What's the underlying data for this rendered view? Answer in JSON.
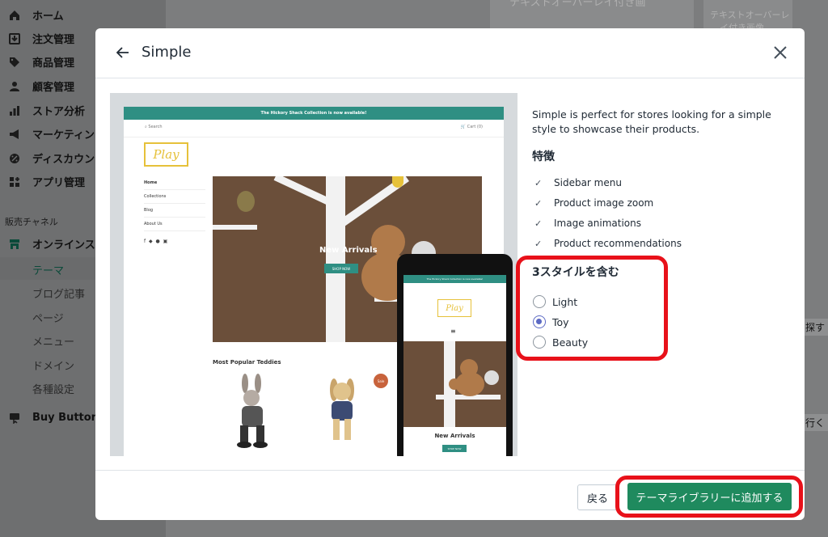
{
  "sidebar": {
    "items": [
      {
        "label": "ホーム",
        "icon": "home-icon"
      },
      {
        "label": "注文管理",
        "icon": "orders-icon"
      },
      {
        "label": "商品管理",
        "icon": "tag-icon"
      },
      {
        "label": "顧客管理",
        "icon": "customer-icon"
      },
      {
        "label": "ストア分析",
        "icon": "analytics-icon"
      },
      {
        "label": "マーケティン",
        "icon": "megaphone-icon"
      },
      {
        "label": "ディスカウン",
        "icon": "discount-icon"
      },
      {
        "label": "アプリ管理",
        "icon": "apps-icon"
      }
    ],
    "channels_heading": "販売チャネル",
    "online_store": "オンラインス",
    "sub_items": [
      "テーマ",
      "ブログ記事",
      "ページ",
      "メニュー",
      "ドメイン",
      "各種設定"
    ],
    "buy_button": "Buy Button"
  },
  "background": {
    "card1_text": "テキストオーバーレイ付き画",
    "card2_text_line1": "テキストオーバーレ",
    "card2_text_line2": "イ付き画像",
    "right_text1": "を探す",
    "right_text2": "に行く"
  },
  "modal": {
    "title": "Simple",
    "description": "Simple is perfect for stores looking for a simple style to showcase their products.",
    "features_title": "特徴",
    "features": [
      "Sidebar menu",
      "Product image zoom",
      "Image animations",
      "Product recommendations"
    ],
    "styles_title": "3スタイルを含む",
    "styles": [
      {
        "label": "Light",
        "checked": false
      },
      {
        "label": "Toy",
        "checked": true
      },
      {
        "label": "Beauty",
        "checked": false
      }
    ],
    "cancel_label": "戻る",
    "add_label": "テーマライブラリーに追加する"
  },
  "preview": {
    "banner": "The Hickory Shack Collection is now available!",
    "search": "Search",
    "cart": "Cart (0)",
    "logo": "Play",
    "menu": [
      "Home",
      "Collections",
      "Blog",
      "About Us"
    ],
    "hero_title": "New Arrivals",
    "hero_button": "SHOP NOW",
    "section_title": "Most Popular Teddies",
    "sale": "Sale",
    "phone_title": "New Arrivals",
    "phone_button": "SHOP NOW"
  },
  "colors": {
    "primary": "#1f8a5e",
    "highlight": "#e8111a",
    "radio_checked": "#5c6ac4",
    "site_accent": "#2f8f83"
  }
}
